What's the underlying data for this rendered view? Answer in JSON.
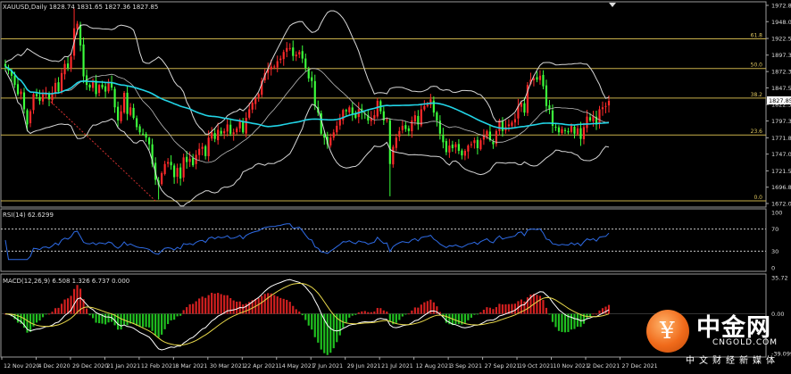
{
  "header": {
    "ohlc": "XAUUSD,Daily  1828.74 1831.65 1827.36 1827.85",
    "rsi": "RSI(14) 62.6299",
    "macd": "MACD(12,26,9) 6.508 1.326 6.737 0.000"
  },
  "colors": {
    "background": "#000000",
    "bull_candle": "#ff2a2a",
    "bear_candle": "#3cff3c",
    "ma_line": "#22d4e6",
    "bollinger": "#d8d8d8",
    "fib_lines": "#c9b04a",
    "rsi_line": "#2e6be6",
    "macd_line": "#ffffff",
    "signal_line": "#e8d84a"
  },
  "logo": {
    "chinese": "中金网",
    "english": "CNGOLD.COM",
    "tagline": "中文财经新媒体",
    "mark": "¥"
  },
  "chart_data": [
    {
      "type": "candlestick",
      "title": "XAUUSD,Daily",
      "ohlc_last": [
        1828.74,
        1831.65,
        1827.36,
        1827.85
      ],
      "ylim": [
        1672.0,
        1972.8
      ],
      "y_ticks": [
        "1972.80",
        "1948.05",
        "1922.55",
        "1897.30",
        "1872.30",
        "1847.55",
        "1822.30",
        "1797.30",
        "1771.80",
        "1747.00",
        "1721.55",
        "1696.80",
        "1672.00"
      ],
      "price_marker": "1827.85",
      "x_ticks": [
        "12 Nov 2020",
        "4 Dec 2020",
        "29 Dec 2020",
        "21 Jan 2021",
        "12 Feb 2021",
        "8 Mar 2021",
        "30 Mar 2021",
        "22 Apr 2021",
        "14 May 2021",
        "7 Jun 2021",
        "29 Jun 2021",
        "21 Jul 2021",
        "12 Aug 2021",
        "3 Sep 2021",
        "27 Sep 2021",
        "19 Oct 2021",
        "10 Nov 2021",
        "2 Dec 2021",
        "27 Dec 2021"
      ],
      "fib_levels": [
        {
          "label": "61.8",
          "price": 1922.0
        },
        {
          "label": "50.0",
          "price": 1877.0
        },
        {
          "label": "38.2",
          "price": 1832.0
        },
        {
          "label": "23.6",
          "price": 1776.0
        },
        {
          "label": "0.0",
          "price": 1676.0
        }
      ],
      "closes": [
        1880,
        1874,
        1866,
        1852,
        1838,
        1842,
        1815,
        1792,
        1812,
        1838,
        1835,
        1828,
        1838,
        1840,
        1830,
        1840,
        1855,
        1842,
        1870,
        1884,
        1878,
        1895,
        1938,
        1945,
        1912,
        1865,
        1852,
        1848,
        1858,
        1838,
        1852,
        1848,
        1842,
        1855,
        1848,
        1818,
        1798,
        1812,
        1840,
        1808,
        1818,
        1802,
        1788,
        1780,
        1778,
        1772,
        1762,
        1732,
        1708,
        1700,
        1718,
        1732,
        1735,
        1730,
        1712,
        1726,
        1710,
        1742,
        1735,
        1740,
        1730,
        1746,
        1755,
        1758,
        1744,
        1772,
        1780,
        1770,
        1784,
        1778,
        1782,
        1792,
        1778,
        1780,
        1786,
        1797,
        1780,
        1802,
        1815,
        1825,
        1832,
        1838,
        1858,
        1870,
        1876,
        1880,
        1880,
        1888,
        1892,
        1902,
        1908,
        1908,
        1896,
        1898,
        1902,
        1892,
        1878,
        1862,
        1858,
        1820,
        1810,
        1778,
        1772,
        1762,
        1772,
        1780,
        1790,
        1800,
        1814,
        1812,
        1818,
        1808,
        1802,
        1815,
        1810,
        1808,
        1798,
        1802,
        1806,
        1828,
        1812,
        1798,
        1800,
        1732,
        1758,
        1772,
        1782,
        1790,
        1785,
        1782,
        1798,
        1806,
        1792,
        1815,
        1820,
        1822,
        1830,
        1810,
        1798,
        1778,
        1765,
        1750,
        1760,
        1756,
        1762,
        1752,
        1745,
        1752,
        1760,
        1762,
        1768,
        1756,
        1768,
        1775,
        1782,
        1768,
        1762,
        1782,
        1798,
        1782,
        1788,
        1792,
        1795,
        1800,
        1820,
        1825,
        1810,
        1852,
        1860,
        1862,
        1860,
        1866,
        1850,
        1820,
        1815,
        1790,
        1788,
        1780,
        1785,
        1782,
        1780,
        1790,
        1778,
        1786,
        1770,
        1788,
        1804,
        1798,
        1805,
        1792,
        1815,
        1818,
        1820,
        1827.85
      ],
      "series": [
        {
          "name": "RSI(14)",
          "last": 62.6299,
          "ylim": [
            0,
            100
          ],
          "levels": [
            70,
            30
          ],
          "y_ticks": [
            "100",
            "70",
            "30",
            "0"
          ]
        },
        {
          "name": "MACD(12,26,9)",
          "values": [
            6.508,
            1.326,
            6.737,
            0.0
          ],
          "y_ticks": [
            "35.72",
            "0.00",
            "-39.099"
          ]
        }
      ]
    }
  ]
}
